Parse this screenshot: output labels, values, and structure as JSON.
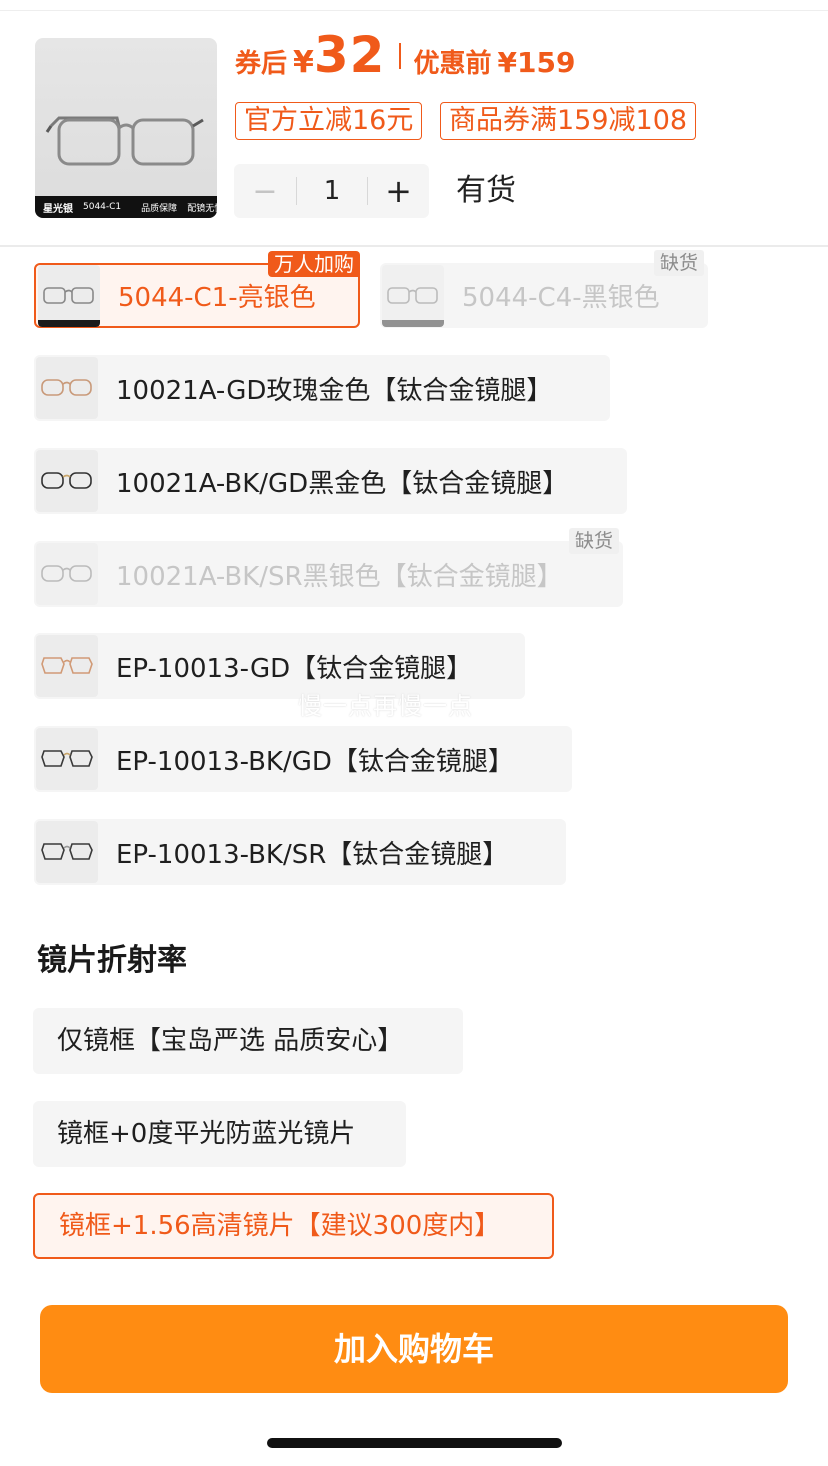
{
  "header": {
    "thumb": {
      "brand": "星光银",
      "model": "5044-C1",
      "tag1": "品质保障",
      "tag2": "配镜无忧"
    },
    "price": {
      "after_label": "券后",
      "currency": "¥",
      "after_value": "32",
      "before_label": "优惠前",
      "before_price": "¥159"
    },
    "promos": [
      "官方立减16元",
      "商品券满159减108"
    ],
    "quantity": {
      "minus": "−",
      "value": "1",
      "plus": "+"
    },
    "stock_text": "有货"
  },
  "colors": {
    "accent": "#f05a1a",
    "cart_button": "#ff8c12",
    "chip_bg": "#f5f5f5"
  },
  "frame_options": [
    {
      "label": "5044-C1-亮银色",
      "state": "selected",
      "tag": "万人加购",
      "icon": "glasses-icon"
    },
    {
      "label": "5044-C4-黑银色",
      "state": "out_of_stock",
      "tag": "缺货",
      "icon": "glasses-icon"
    },
    {
      "label": "10021A-GD玫瑰金色【钛合金镜腿】",
      "state": "normal",
      "tag": "",
      "icon": "glasses-icon"
    },
    {
      "label": "10021A-BK/GD黑金色【钛合金镜腿】",
      "state": "normal",
      "tag": "",
      "icon": "glasses-icon"
    },
    {
      "label": "10021A-BK/SR黑银色【钛合金镜腿】",
      "state": "out_of_stock",
      "tag": "缺货",
      "icon": "glasses-icon"
    },
    {
      "label": "EP-10013-GD【钛合金镜腿】",
      "state": "normal",
      "tag": "",
      "icon": "glasses-icon"
    },
    {
      "label": "EP-10013-BK/GD【钛合金镜腿】",
      "state": "normal",
      "tag": "",
      "icon": "glasses-icon"
    },
    {
      "label": "EP-10013-BK/SR【钛合金镜腿】",
      "state": "normal",
      "tag": "",
      "icon": "glasses-icon"
    }
  ],
  "watermark": "慢一点再慢一点",
  "lens_section": {
    "title": "镜片折射率",
    "options": [
      {
        "label": "仅镜框【宝岛严选 品质安心】",
        "state": "normal"
      },
      {
        "label": "镜框+0度平光防蓝光镜片",
        "state": "normal"
      },
      {
        "label": "镜框+1.56高清镜片【建议300度内】",
        "state": "selected"
      }
    ]
  },
  "cart_button_label": "加入购物车"
}
